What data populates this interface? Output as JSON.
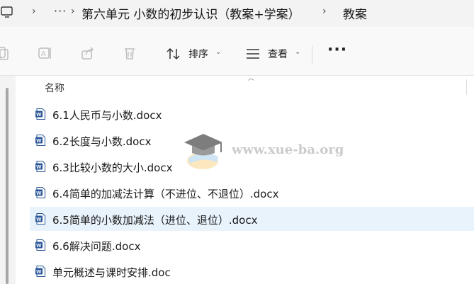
{
  "breadcrumb": {
    "more": "···",
    "items": [
      "第六单元  小数的初步认识（教案+学案）",
      "教案"
    ]
  },
  "toolbar": {
    "sort_label": "排序",
    "view_label": "查看",
    "more_label": "···"
  },
  "list": {
    "column_header": "名称",
    "files": [
      "6.1人民币与小数.docx",
      "6.2长度与小数.docx",
      "6.3比较小数的大小.docx",
      "6.4简单的加减法计算（不进位、不退位）.docx",
      "6.5简单的小数加减法（进位、退位）.docx",
      "6.6解决问题.docx",
      "单元概述与课时安排.doc"
    ],
    "selected_index": 4
  },
  "watermark": {
    "text": "www.xue-ba.org"
  },
  "colors": {
    "word_blue": "#2b579a",
    "selection": "#e9f3fb"
  }
}
